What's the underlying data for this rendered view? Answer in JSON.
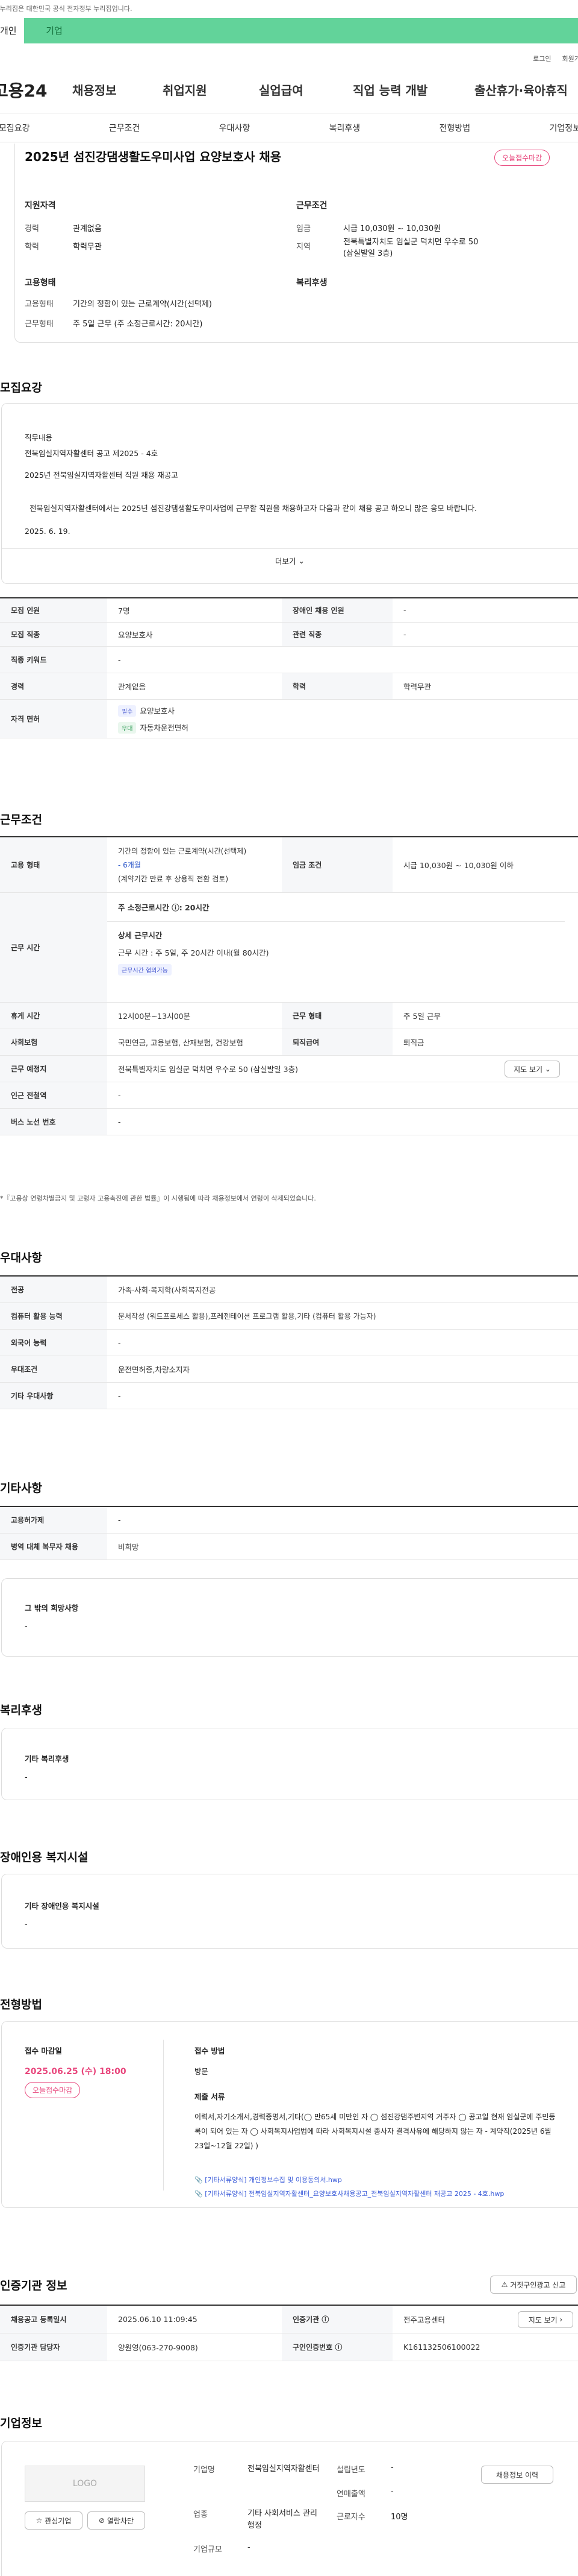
{
  "gov_notice": "이 누리집은 대한민국 공식 전자정부 누리집입니다.",
  "top_tabs": [
    "개인",
    "기업"
  ],
  "util": [
    "로그인",
    "회원가입"
  ],
  "logo": "고용24",
  "gnb": [
    "채용정보",
    "취업지원",
    "실업급여",
    "직업 능력 개발",
    "출산휴가·육아휴직"
  ],
  "lnb": [
    "모집요강",
    "근무조건",
    "우대사항",
    "복리후생",
    "전형방법",
    "기업정보"
  ],
  "job": {
    "title": "2025년 섬진강댐생활도우미사업 요양보호사 채용",
    "deadline_badge": "오늘접수마감",
    "qual_title": "지원자격",
    "career_l": "경력",
    "career_v": "관계없음",
    "edu_l": "학력",
    "edu_v": "학력무관",
    "cond_title": "근무조건",
    "wage_l": "임금",
    "wage_v": "시급 10,030원 ~ 10,030원",
    "area_l": "지역",
    "area_v": "전북특별자치도 임실군 덕치면 우수로 50 (삼실발일 3층)",
    "emp_title": "고용형태",
    "emptype_l": "고용형태",
    "emptype_v": "기간의 정함이 있는 근로계약(시간(선택제)",
    "worktime_l": "근무형태",
    "worktime_v": "주 5일 근무 (주 소정근로시간: 20시간)",
    "welfare_title": "복리후생"
  },
  "recruit": {
    "title": "모집요강",
    "duty_l": "직무내용",
    "duty1": "전북임실지역자활센터 공고 제2025 - 4호",
    "duty2": "2025년 전북임실지역자활센터 직원 채용 재공고",
    "duty3": "전북임실지역자활센터에서는 2025년 섬진강댐생활도우미사업에 근무할 직원을 채용하고자 다음과 같이 채용 공고 하오니 많은 응모 바랍니다.",
    "duty4": "2025.  6.  19.",
    "more": "더보기",
    "rows": [
      [
        "모집 인원",
        "7명",
        "장애인 채용 인원",
        "-"
      ],
      [
        "모집 직종",
        "요양보호사",
        "관련 직종",
        "-"
      ],
      [
        "직종 키워드",
        "-",
        "",
        ""
      ],
      [
        "경력",
        "관계없음",
        "학력",
        "학력무관"
      ]
    ],
    "license_l": "자격 면허",
    "lic1_tag": "필수",
    "lic1": "요양보호사",
    "lic2_tag": "우대",
    "lic2": "자동차운전면허"
  },
  "work": {
    "title": "근무조건",
    "emp_l": "고용 형태",
    "emp_v1": "기간의 정함이 있는 근로계약(시간(선택제)",
    "emp_v2": "- 6개월",
    "emp_v3": "(계약기간 만료 후 상용직 전환 검토)",
    "wage_l": "임금 조건",
    "wage_v": "시급 10,030원 ~ 10,030원 이하",
    "hours_l": "근무 시간",
    "hours_main": "주 소정근로시간 ⓘ: 20시간",
    "hours_sub_l": "상세 근무시간",
    "hours_sub": "근무 시간 : 주 5일, 주 20시간 이내(월 80시간)",
    "hours_tag": "근무시간 협의가능",
    "rows": [
      [
        "휴게 시간",
        "12시00분~13시00분",
        "근무 형태",
        "주 5일 근무"
      ],
      [
        "사회보험",
        "국민연금, 고용보험, 산재보험, 건강보험",
        "퇴직급여",
        "퇴직금"
      ]
    ],
    "place_l": "근무 예정지",
    "place_v": "전북특별자치도 임실군 덕치면 우수로 50 (삼실발일 3층)",
    "map_btn": "지도 보기",
    "station_l": "인근 전철역",
    "station_v": "-",
    "bus_l": "버스 노선 번호",
    "bus_v": "-",
    "note": "*『고용상 연령차별금지 및 고령자 고용촉진에 관한 법률』이 시행됨에 따라 채용정보에서 연령이 삭제되었습니다."
  },
  "pref": {
    "title": "우대사항",
    "rows": [
      [
        "전공",
        "가족·사회·복지학(사회복지전공"
      ],
      [
        "컴퓨터 활용 능력",
        "문서작성 (워드프로세스 활용),프레젠테이션 프로그램 활용,기타 (컴퓨터 활용 가능자)"
      ],
      [
        "외국어 능력",
        "-"
      ],
      [
        "우대조건",
        "운전면허증,차량소지자"
      ],
      [
        "기타 우대사항",
        "-"
      ]
    ]
  },
  "etc": {
    "title": "기타사항",
    "rows": [
      [
        "고용허가제",
        "-"
      ],
      [
        "병역 대체 복무자 채용",
        "비희망"
      ]
    ],
    "hope_l": "그 밖의 희망사항",
    "hope_v": "-"
  },
  "welfare": {
    "title": "복리후생",
    "l": "기타 복리후생",
    "v": "-"
  },
  "disab": {
    "title": "장애인용 복지시설",
    "l": "기타 장애인용 복지시설",
    "v": "-"
  },
  "screen": {
    "title": "전형방법",
    "deadline_l": "접수 마감일",
    "deadline_v": "2025.06.25 (수) 18:00",
    "deadline_badge": "오늘접수마감",
    "method_l": "접수 방법",
    "method_v": "방문",
    "docs_l": "제출 서류",
    "docs_v": "이력서,자기소개서,경력증명서,기타(◯ 만65세 미만인 자   ◯ 섬진강댐주변지역 거주자   ◯ 공고일 현재 임실군에 주민등록이 되어 있는 자   ◯ 사회복지사업법에 따라 사회복지시설 종사자 결격사유에 해당하지 않는 자 - 계약직(2025년 6월23일~12월 22일) )",
    "file1": "[기타서류양식] 개인정보수집 및 이용동의서.hwp",
    "file2": "[기타서류양식] 전북임실지역자활센터_요양보호사채용공고_전북임실지역자활센터 재공고 2025 - 4호.hwp"
  },
  "agency": {
    "title": "인증기관 정보",
    "report_btn": "거짓구인광고 신고",
    "reg_l": "채용공고 등록일시",
    "reg_v": "2025.06.10 11:09:45",
    "org_l": "인증기관 ⓘ",
    "org_v": "전주고용센터",
    "map_btn": "지도 보기",
    "mgr_l": "인증기관 담당자",
    "mgr_v": "양원영(063-270-9008)",
    "id_l": "구인인증번호 ⓘ",
    "id_v": "K161132506100022"
  },
  "company": {
    "title": "기업정보",
    "logo": "LOGO",
    "fav_btn": "관심기업",
    "block_btn": "열람차단",
    "name_l": "기업명",
    "name_v": "전북임실지역자활센터",
    "ind_l": "업종",
    "ind_v": "기타 사회서비스 관리 행정",
    "year_l": "설립년도",
    "year_v": "-",
    "sales_l": "연매출액",
    "sales_v": "-",
    "emp_l": "근로자수",
    "emp_v": "10명",
    "scale_l": "기업규모",
    "scale_v": "-",
    "history_btn": "채용정보 이력"
  }
}
